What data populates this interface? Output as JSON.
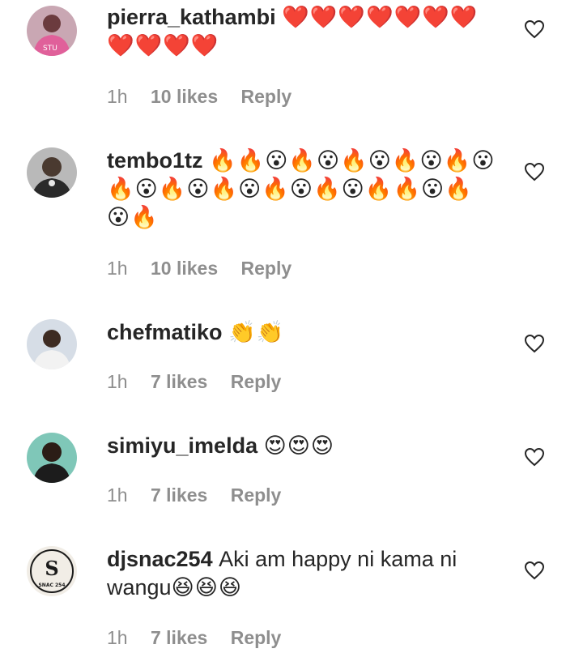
{
  "comments": [
    {
      "username": "pierra_kathambi",
      "text": "",
      "emoji": "❤️❤️❤️❤️❤️❤️❤️❤️❤️❤️❤️",
      "time": "1h",
      "likes": "10 likes",
      "reply": "Reply"
    },
    {
      "username": "tembo1tz",
      "text": "",
      "emoji": "🔥🔥😮🔥😮🔥😮🔥😮🔥😮🔥😮🔥😮🔥😮🔥😮🔥😮🔥🔥😮🔥😮🔥",
      "time": "1h",
      "likes": "10 likes",
      "reply": "Reply"
    },
    {
      "username": "chefmatiko",
      "text": "",
      "emoji": "👏👏",
      "time": "1h",
      "likes": "7 likes",
      "reply": "Reply"
    },
    {
      "username": "simiyu_imelda",
      "text": "",
      "emoji": "😍😍😍",
      "time": "1h",
      "likes": "7 likes",
      "reply": "Reply"
    },
    {
      "username": "djsnac254",
      "text": "Aki am happy ni kama ni wangu",
      "emoji": "😆😆😆",
      "time": "1h",
      "likes": "7 likes",
      "reply": "Reply"
    }
  ],
  "avatar_logo_text": "SNAC 254",
  "colors": {
    "text": "#262626",
    "meta": "#8e8e8e",
    "heart_outline": "#262626"
  }
}
